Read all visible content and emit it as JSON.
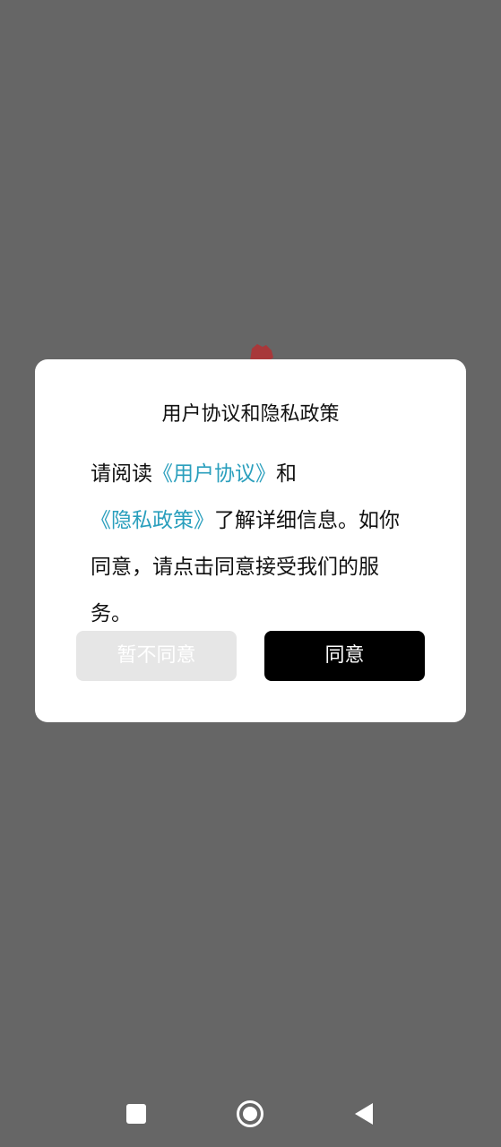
{
  "dialog": {
    "title": "用户协议和隐私政策",
    "body": {
      "prefix": "请阅读",
      "user_agreement_link": "《用户协议》",
      "conjunction": "和",
      "privacy_policy_link": "《隐私政策》",
      "suffix": "了解详细信息。如你同意，请点击同意接受我们的服务。"
    },
    "decline_label": "暂不同意",
    "agree_label": "同意"
  },
  "colors": {
    "backdrop": "#666666",
    "link": "#2a9fbd",
    "agree_button": "#000000",
    "decline_button": "#e6e6e6",
    "splash_logo": "#a8383a"
  },
  "nav_bar": {
    "recents_icon": "square-icon",
    "home_icon": "circle-icon",
    "back_icon": "triangle-back-icon"
  }
}
